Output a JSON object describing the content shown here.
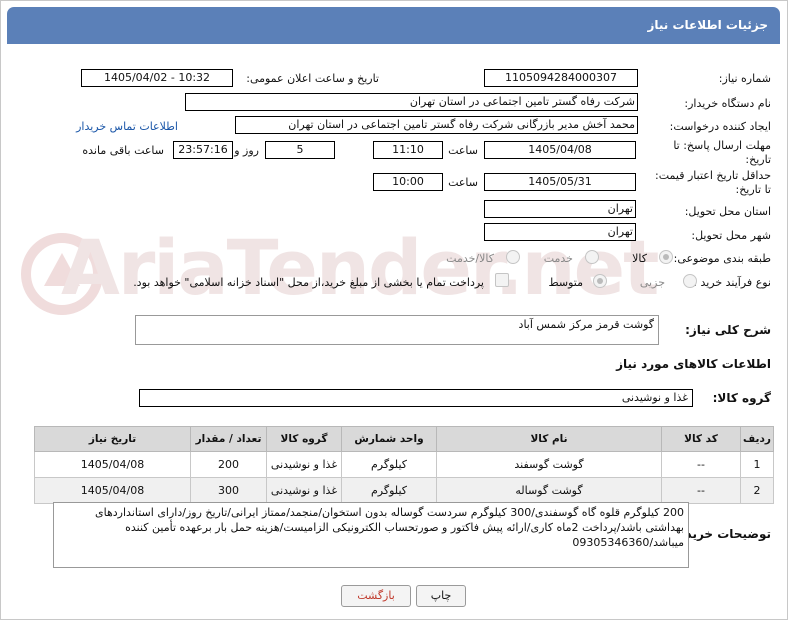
{
  "header": {
    "title": "جزئیات اطلاعات نیاز"
  },
  "watermark": "AriaTender.net",
  "fields": {
    "need_number_label": "شماره نیاز:",
    "need_number": "1105094284000307",
    "announce_label": "تاریخ و ساعت اعلان عمومی:",
    "announce_value": "1405/04/02 - 10:32",
    "buyer_org_label": "نام دستگاه خریدار:",
    "buyer_org": "شرکت رفاه گستر تامین اجتماعی در استان تهران",
    "requester_label": "ایجاد کننده درخواست:",
    "requester": "محمد آخش مدیر بازرگانی شرکت رفاه گستر تامین اجتماعی در استان تهران",
    "contact_link": "اطلاعات تماس خریدار",
    "deadline_label_1": "مهلت ارسال پاسخ: تا",
    "deadline_label_2": "تاریخ:",
    "deadline_date": "1405/04/08",
    "time_label": "ساعت",
    "deadline_time": "11:10",
    "days_value": "5",
    "days_label": "روز و",
    "remaining_time": "23:57:16",
    "remaining_label": "ساعت باقی مانده",
    "validity_label_1": "حداقل تاریخ اعتبار قیمت:",
    "validity_label_2": "تا تاریخ:",
    "validity_date": "1405/05/31",
    "validity_time": "10:00",
    "province_label": "استان محل تحویل:",
    "province": "تهران",
    "city_label": "شهر محل تحویل:",
    "city": "تهران",
    "category_label": "طبقه بندی موضوعی:",
    "category_options": [
      "کالا",
      "خدمت",
      "کالا/خدمت"
    ],
    "process_label": "نوع فرآیند خرید :",
    "process_options": [
      "جزیی",
      "متوسط"
    ],
    "payment_text": "پرداخت تمام یا بخشی از مبلغ خرید،از محل \"اسناد خزانه اسلامی\" خواهد بود."
  },
  "description": {
    "label": "شرح کلی نیاز:",
    "value": "گوشت قرمز مرکز شمس آباد"
  },
  "goods": {
    "section_title": "اطلاعات کالاهای مورد نیاز",
    "group_label": "گروه کالا:",
    "group_value": "غذا و نوشیدنی",
    "columns": [
      "ردیف",
      "کد کالا",
      "نام کالا",
      "واحد شمارش",
      "گروه کالا",
      "تعداد / مقدار",
      "تاریخ نیاز"
    ],
    "rows": [
      [
        "1",
        "--",
        "گوشت گوسفند",
        "کیلوگرم",
        "غذا و نوشیدنی",
        "200",
        "1405/04/08"
      ],
      [
        "2",
        "--",
        "گوشت گوساله",
        "کیلوگرم",
        "غذا و نوشیدنی",
        "300",
        "1405/04/08"
      ]
    ]
  },
  "buyer_notes": {
    "label": "توضیحات خریدار:",
    "value": "200 کیلوگرم قلوه گاه گوسفندی/300 کیلوگرم سردست گوساله بدون استخوان/منجمد/ممتاز ایرانی/تاریخ روز/دارای استانداردهای بهداشتی باشد/پرداخت 2ماه کاری/ارائه پیش فاکتور و صورتحساب الکترونیکی الزامیست/هزینه حمل بار برعهده تأمین کننده میباشد/09305346360"
  },
  "buttons": {
    "print": "چاپ",
    "back": "بازگشت"
  }
}
